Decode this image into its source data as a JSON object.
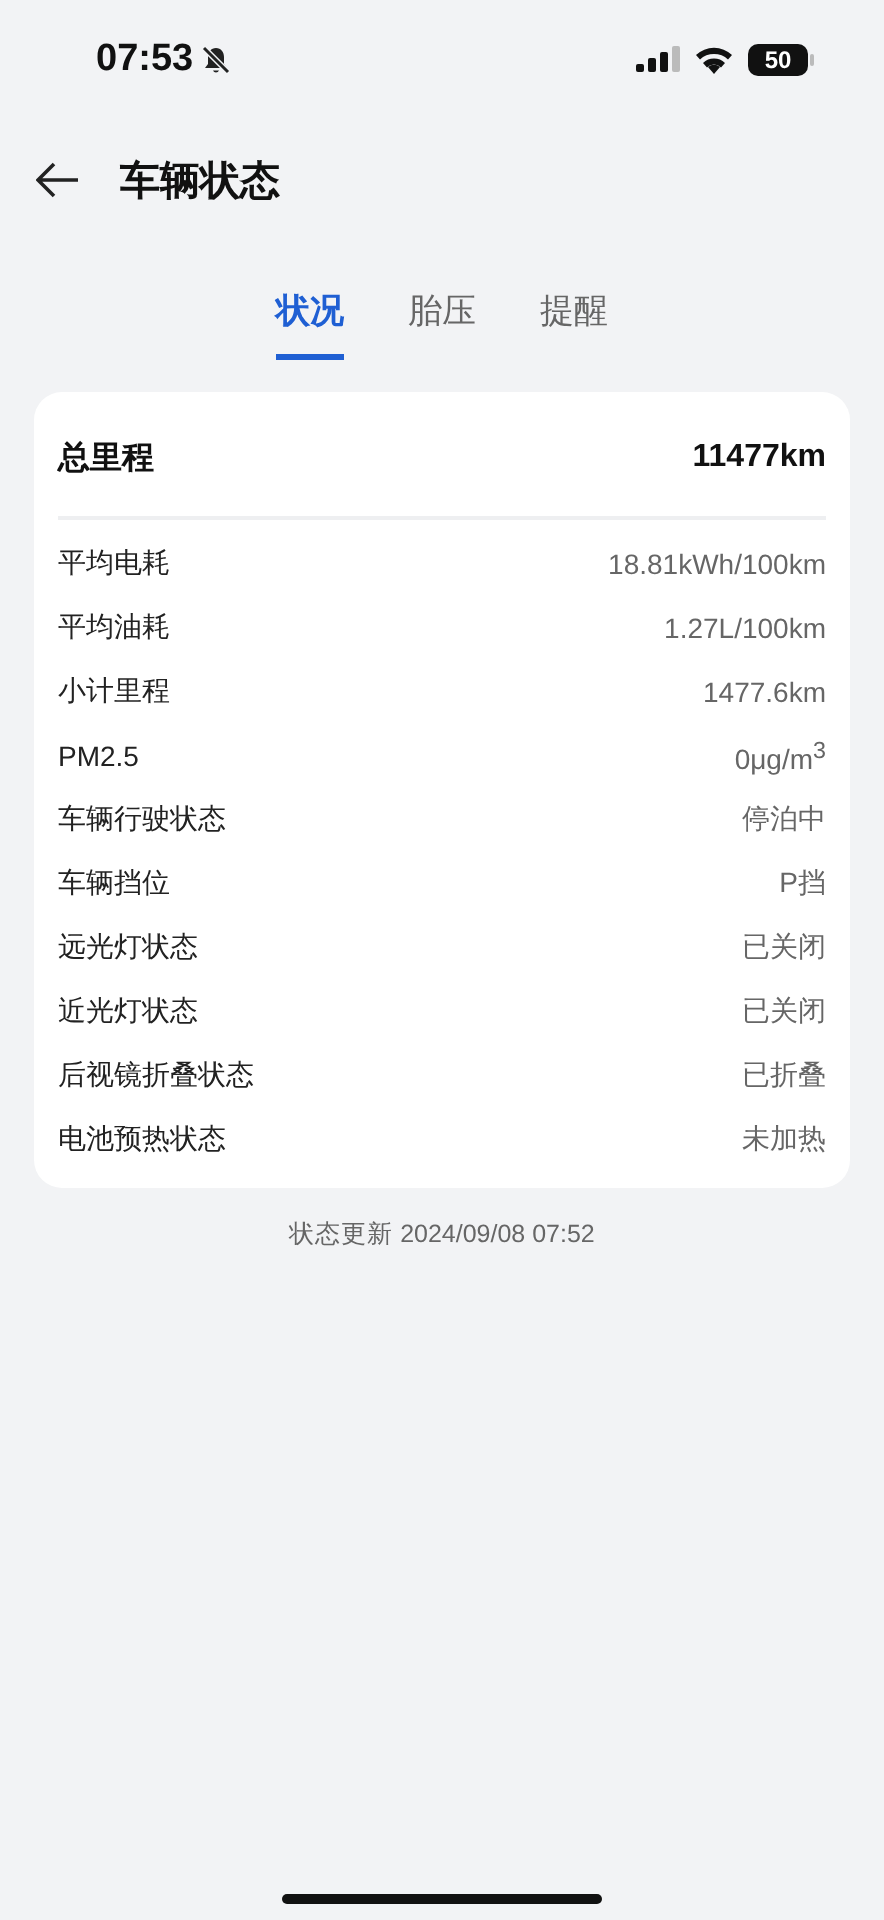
{
  "status_bar": {
    "time": "07:53",
    "battery": "50"
  },
  "header": {
    "title": "车辆状态"
  },
  "tabs": [
    {
      "label": "状况",
      "selected": true
    },
    {
      "label": "胎压",
      "selected": false
    },
    {
      "label": "提醒",
      "selected": false
    }
  ],
  "summary": {
    "label": "总里程",
    "value": "11477km"
  },
  "rows": [
    {
      "label": "平均电耗",
      "value": "18.81kWh/100km"
    },
    {
      "label": "平均油耗",
      "value": "1.27L/100km"
    },
    {
      "label": "小计里程",
      "value": "1477.6km"
    },
    {
      "label": "PM2.5",
      "value": "0μg/m$^{3}$"
    },
    {
      "label": "车辆行驶状态",
      "value": "停泊中"
    },
    {
      "label": "车辆挡位",
      "value": "P挡"
    },
    {
      "label": "远光灯状态",
      "value": "已关闭"
    },
    {
      "label": "近光灯状态",
      "value": "已关闭"
    },
    {
      "label": "后视镜折叠状态",
      "value": "已折叠"
    },
    {
      "label": "电池预热状态",
      "value": "未加热"
    }
  ],
  "footer": {
    "text": "状态更新 2024/09/08 07:52"
  }
}
